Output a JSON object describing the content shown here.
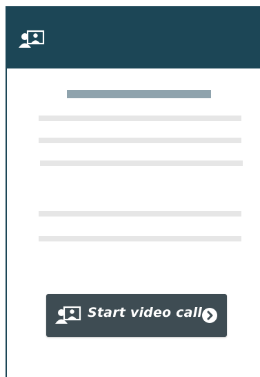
{
  "colors": {
    "header": "#1c4656",
    "button": "#3e4c53",
    "skeleton": "#e6e6e6",
    "skeleton_title": "#8fa3ad",
    "icon": "#ffffff"
  },
  "header": {
    "icon": "video-call-icon"
  },
  "content": {
    "skeleton_title": "",
    "skeleton_lines": [
      "",
      "",
      "",
      "",
      ""
    ]
  },
  "cta": {
    "label": "Start video call",
    "icon": "video-call-icon",
    "arrow_icon": "chevron-right-circle-icon"
  }
}
